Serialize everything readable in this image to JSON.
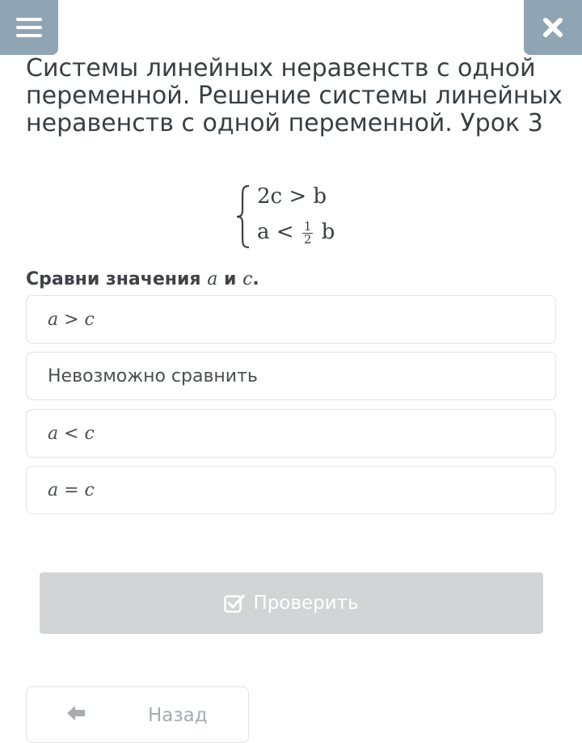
{
  "header": {
    "menu_icon": "hamburger-menu-icon",
    "close_icon": "close-x-icon",
    "accent_color": "#8fa5b3"
  },
  "lesson": {
    "title": "Системы линейных неравенств с одной переменной. Решение системы линейных неравенств с одной переменной. Урок 3"
  },
  "system": {
    "line1": "2c > b",
    "line2_left": "a <",
    "fraction_numerator": "1",
    "fraction_denominator": "2",
    "line2_right": "b"
  },
  "question": {
    "prefix": "Сравни значения",
    "var_a": "a",
    "conjunction": "и",
    "var_c": "c",
    "suffix": "."
  },
  "options": [
    {
      "label": "a > c"
    },
    {
      "label": "Невозможно сравнить"
    },
    {
      "label": "a < c"
    },
    {
      "label": "a = c"
    }
  ],
  "actions": {
    "check_label": "Проверить",
    "check_icon": "checkbox-check-icon",
    "back_label": "Назад",
    "back_icon": "arrow-left-icon"
  }
}
